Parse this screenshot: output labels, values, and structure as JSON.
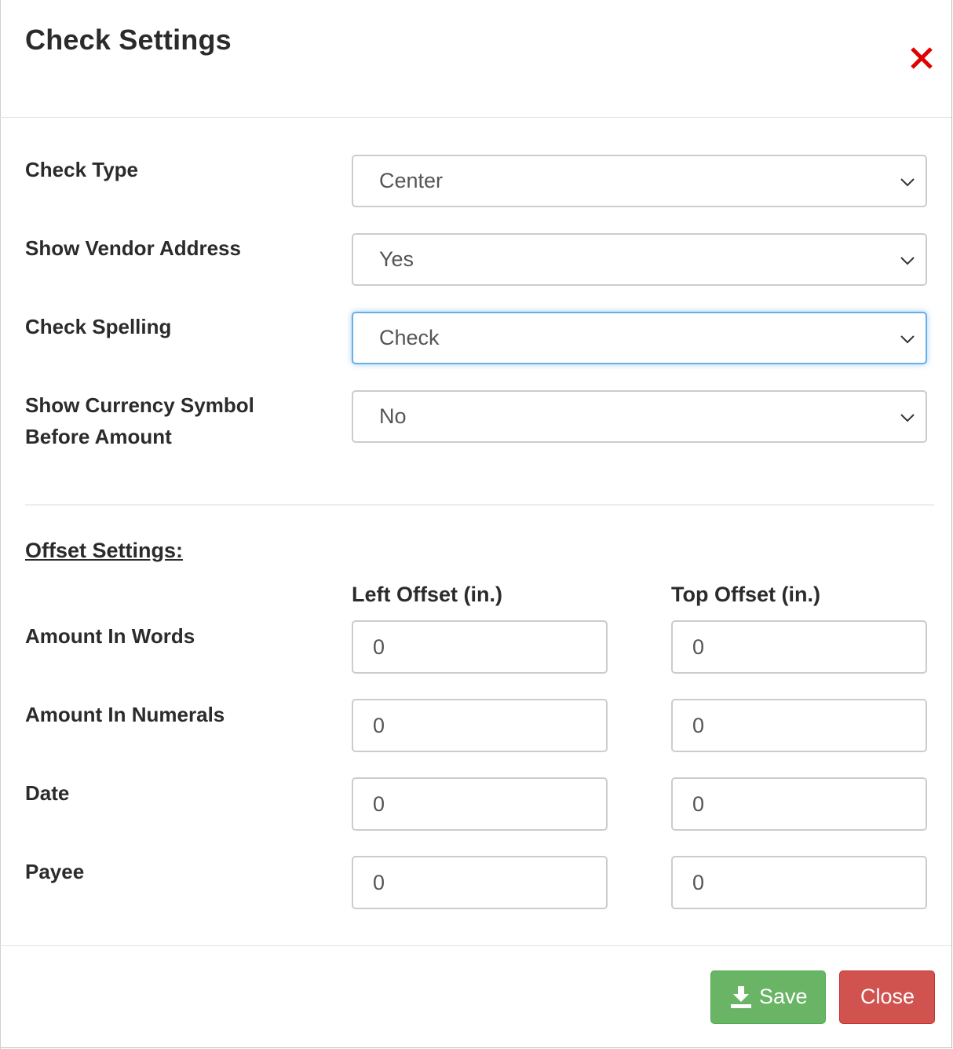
{
  "dialog": {
    "title": "Check Settings",
    "close_icon": "close-x-icon",
    "close_icon_color": "#e00000"
  },
  "settings": [
    {
      "label": "Check Type",
      "value": "Center"
    },
    {
      "label": "Show Vendor Address",
      "value": "Yes"
    },
    {
      "label": "Check Spelling",
      "value": "Check"
    },
    {
      "label_line1": "Show Currency Symbol",
      "label_line2": "Before Amount",
      "value": "No"
    }
  ],
  "offset": {
    "title": "Offset Settings:",
    "left_header": "Left Offset (in.)",
    "top_header": "Top Offset (in.)",
    "rows": [
      {
        "label": "Amount In Words",
        "left": "0",
        "top": "0"
      },
      {
        "label": "Amount In Numerals",
        "left": "0",
        "top": "0"
      },
      {
        "label": "Date",
        "left": "0",
        "top": "0"
      },
      {
        "label": "Payee",
        "left": "0",
        "top": "0"
      }
    ]
  },
  "footer": {
    "save_label": "Save",
    "save_icon": "download-icon",
    "close_label": "Close",
    "save_color": "#6ab465",
    "close_color": "#d05350"
  }
}
